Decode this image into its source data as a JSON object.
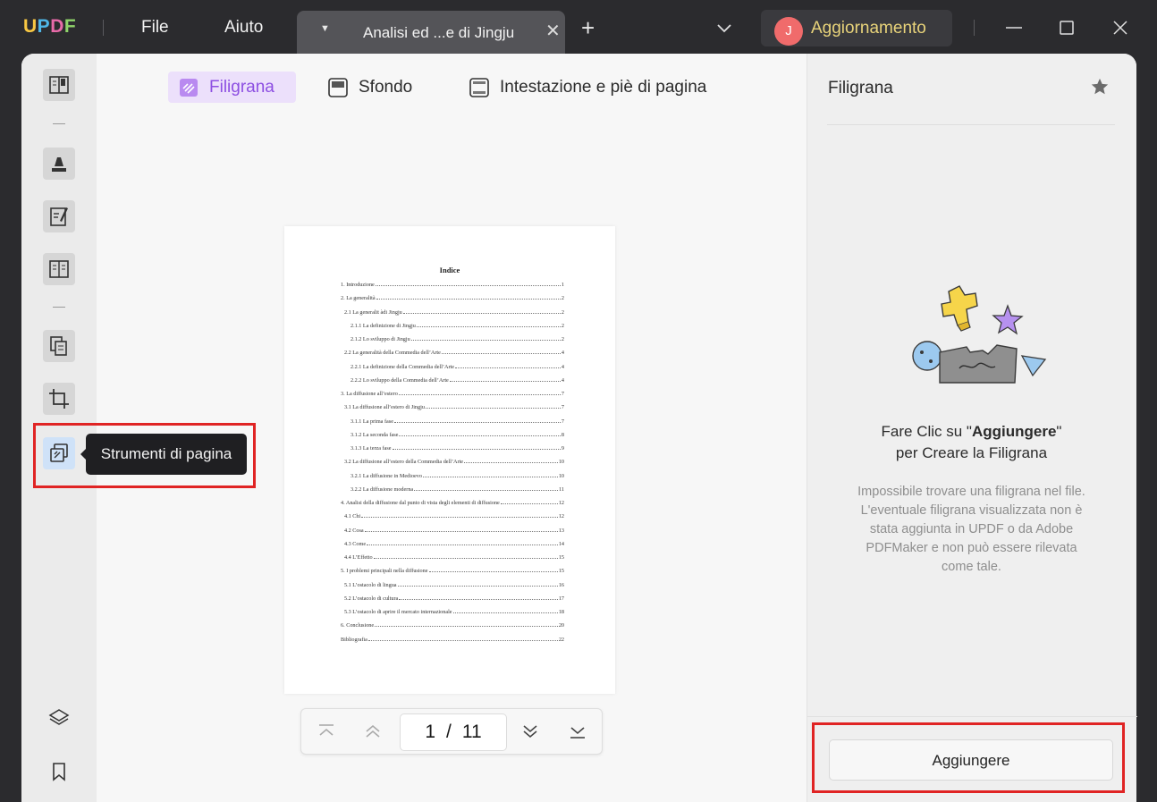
{
  "app": {
    "logo": {
      "u": "U",
      "p": "P",
      "d": "D",
      "f": "F"
    },
    "menu": {
      "file": "File",
      "help": "Aiuto"
    },
    "tab_title": "Analisi ed ...e di Jingju",
    "upgrade": {
      "avatar_letter": "J",
      "label": "Aggiornamento"
    }
  },
  "toolbar": {
    "tabs": [
      {
        "label": "Filigrana",
        "active": true
      },
      {
        "label": "Sfondo",
        "active": false
      },
      {
        "label": "Intestazione e piè di pagina",
        "active": false
      }
    ]
  },
  "sidebar": {
    "tooltip": "Strumenti di pagina"
  },
  "document": {
    "title": "Indice",
    "toc": [
      {
        "text": "1. Introduzione",
        "page": "1",
        "level": 0
      },
      {
        "text": "2. La generalità",
        "page": "2",
        "level": 0
      },
      {
        "text": "2.1 La generalit àdi Jingju",
        "page": "2",
        "level": 1
      },
      {
        "text": "2.1.1 La definizione di Jingju",
        "page": "2",
        "level": 2
      },
      {
        "text": "2.1.2 Lo sviluppo di Jingju",
        "page": "2",
        "level": 2
      },
      {
        "text": "2.2 La generalità della Commedia dell’Arte",
        "page": "4",
        "level": 1
      },
      {
        "text": "2.2.1 La definizione della Commedia dell’Arte",
        "page": "4",
        "level": 2
      },
      {
        "text": "2.2.2 Lo sviluppo della Commedia dell’Arte",
        "page": "4",
        "level": 2
      },
      {
        "text": "3. La diffusione all’estero",
        "page": "7",
        "level": 0
      },
      {
        "text": "3.1 La diffusione all’estero di Jingju",
        "page": "7",
        "level": 1
      },
      {
        "text": "3.1.1 La prima fase",
        "page": "7",
        "level": 2
      },
      {
        "text": "3.1.2 La seconda fase",
        "page": "8",
        "level": 2
      },
      {
        "text": "3.1.3 La terza fase",
        "page": "9",
        "level": 2
      },
      {
        "text": "3.2 La diffusione all’estero della Commedia dell’Arte",
        "page": "10",
        "level": 1
      },
      {
        "text": "3.2.1 La diffusione in Medioevo",
        "page": "10",
        "level": 2
      },
      {
        "text": "3.2.2 La diffusione moderna",
        "page": "11",
        "level": 2
      },
      {
        "text": "4. Analisi della diffusione dal punto di vista degli elementi di diffusione",
        "page": "12",
        "level": 0
      },
      {
        "text": "4.1 Chi",
        "page": "12",
        "level": 1
      },
      {
        "text": "4.2 Cosa",
        "page": "13",
        "level": 1
      },
      {
        "text": "4.3 Come",
        "page": "14",
        "level": 1
      },
      {
        "text": "4.4 L’Effetto",
        "page": "15",
        "level": 1
      },
      {
        "text": "5. I problemi principali nella diffusione",
        "page": "15",
        "level": 0
      },
      {
        "text": "5.1 L’ostacolo di lingua",
        "page": "16",
        "level": 1
      },
      {
        "text": "5.2 L’ostacolo di cultura",
        "page": "17",
        "level": 1
      },
      {
        "text": "5.3 L’ostacolo di aprire il mercato internazionale",
        "page": "18",
        "level": 1
      },
      {
        "text": "6. Conclusione",
        "page": "20",
        "level": 0
      },
      {
        "text": "Bibliografia",
        "page": "22",
        "level": 0
      }
    ]
  },
  "pager": {
    "current": "1",
    "separator": "/",
    "total": "11"
  },
  "panel": {
    "title": "Filigrana",
    "heading_pre": "Fare Clic su \"",
    "heading_bold": "Aggiungere",
    "heading_post": "\"",
    "heading_line2": "per Creare la Filigrana",
    "description": "Impossibile trovare una filigrana nel file. L'eventuale filigrana visualizzata non è stata aggiunta in UPDF o da Adobe PDFMaker e non può essere rilevata come tale.",
    "add_button": "Aggiungere"
  },
  "colors": {
    "accent": "#8d4fe2",
    "highlight_box": "#e02424",
    "active_tab_bg": "#ece0fb"
  }
}
